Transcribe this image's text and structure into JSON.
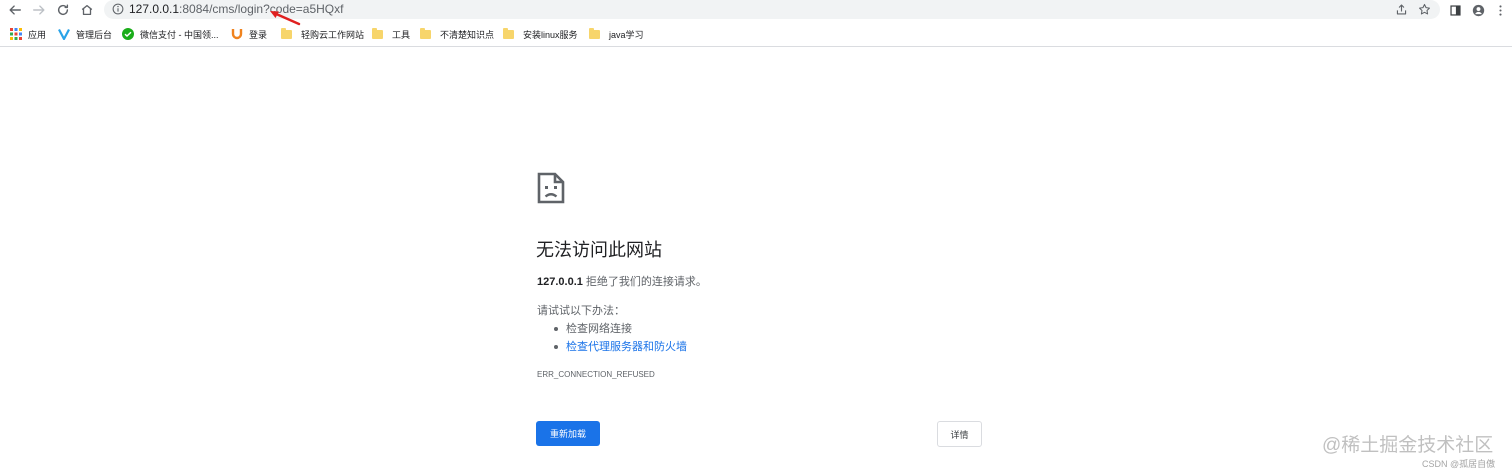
{
  "browser": {
    "url_host": "127.0.0.1",
    "url_rest": ":8084/cms/login?code=a5HQxf",
    "icons": {
      "back": "arrow-left-icon",
      "forward": "arrow-right-icon",
      "reload": "reload-icon",
      "home": "home-icon",
      "site_info": "info-icon",
      "share": "share-icon",
      "bookmark": "star-icon",
      "sidebar": "side-panel-icon",
      "profile": "profile-icon",
      "menu": "kebab-menu-icon"
    }
  },
  "bookmarks": [
    {
      "label": "应用",
      "icon": "apps-grid-icon"
    },
    {
      "label": "管理后台",
      "icon": "v-logo-icon"
    },
    {
      "label": "微信支付 - 中国领...",
      "icon": "wechat-icon"
    },
    {
      "label": "登录",
      "icon": "u-logo-icon"
    },
    {
      "label": "轻购云工作网站",
      "icon": "folder-icon"
    },
    {
      "label": "工具",
      "icon": "folder-icon"
    },
    {
      "label": "不清楚知识点",
      "icon": "folder-icon"
    },
    {
      "label": "安装linux服务",
      "icon": "folder-icon"
    },
    {
      "label": "java学习",
      "icon": "folder-icon"
    }
  ],
  "error_page": {
    "icon": "sad-page-icon",
    "title": "无法访问此网站",
    "host": "127.0.0.1",
    "description": " 拒绝了我们的连接请求。",
    "try_heading": "请试试以下办法：",
    "suggestions": [
      "检查网络连接",
      "检查代理服务器和防火墙"
    ],
    "error_code": "ERR_CONNECTION_REFUSED",
    "reload_label": "重新加载",
    "details_label": "详情"
  },
  "watermark": {
    "main": "@稀土掘金技术社区",
    "sub": "CSDN @孤居自傲"
  },
  "colors": {
    "accent": "#1a73e8",
    "annotation": "#e02020",
    "folder": "#f7d56b"
  }
}
